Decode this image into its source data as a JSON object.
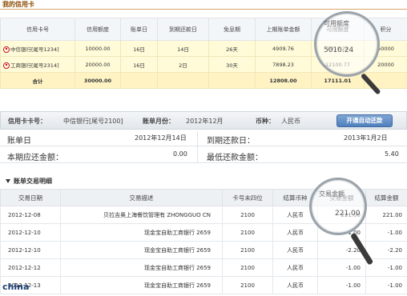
{
  "cards_panel": {
    "title": "我的信用卡",
    "headers": [
      "信用卡号",
      "信用额度",
      "账单日",
      "到期还款日",
      "免息期",
      "上期账单金额",
      "可用额度",
      "积分"
    ],
    "rows": [
      {
        "bank": "中信银行[尾号1234]",
        "limit": "10000.00",
        "bill_day": "16日",
        "due_day": "14日",
        "interest_free": "26天",
        "last_bill": "4909.76",
        "available": "5010.24",
        "points": "50000"
      },
      {
        "bank": "工商银行[尾号2314]",
        "limit": "20000.00",
        "bill_day": "16日",
        "due_day": "2日",
        "interest_free": "30天",
        "last_bill": "7898.23",
        "available": "12100.77",
        "points": "20000"
      }
    ],
    "total": {
      "label": "合计",
      "limit": "30000.00",
      "last_bill": "12808.00",
      "available": "17111.01"
    }
  },
  "bill_header": {
    "card_label": "信用卡卡号：",
    "card_value": "中信银行[尾号2100]",
    "month_label": "账单月份：",
    "month_value": "2012年12月",
    "currency_label": "币种：",
    "currency_value": "人民币",
    "auto_repay_button": "开通自动还款"
  },
  "bill_summary": {
    "bill_date_label": "账单日",
    "bill_date_value": "2012年12月14日",
    "due_date_label": "到期还款日：",
    "due_date_value": "2013年1月2日",
    "current_due_label": "本期应还金额：",
    "current_due_value": "0.00",
    "min_due_label": "最低还款金额：",
    "min_due_value": "5.40"
  },
  "transactions": {
    "section_title": "账单交易明细",
    "headers": [
      "交易日期",
      "交易描述",
      "卡号末四位",
      "结算币种",
      "交易金额",
      "结算金额"
    ],
    "rows": [
      {
        "date": "2012-12-08",
        "desc": "贝拉吉奥上海餐饮管理有 ZHONGGUO CN",
        "card": "2100",
        "currency": "人民币",
        "amount": "221.00",
        "settle": "221.00"
      },
      {
        "date": "2012-12-10",
        "desc": "现金宝自助工商银行 2659",
        "card": "2100",
        "currency": "人民币",
        "amount": "-1.00",
        "settle": "-1.00"
      },
      {
        "date": "2012-12-10",
        "desc": "现金宝自助工商银行 2659",
        "card": "2100",
        "currency": "人民币",
        "amount": "-2.20",
        "settle": "-2.20"
      },
      {
        "date": "2012-12-12",
        "desc": "现金宝自助工商银行 2659",
        "card": "2100",
        "currency": "人民币",
        "amount": "-1.00",
        "settle": "-1.00"
      },
      {
        "date": "2012-12-13",
        "desc": "现金宝自助工商银行 2659",
        "card": "2100",
        "currency": "人民币",
        "amount": "-1.00",
        "settle": "-1.00"
      }
    ]
  },
  "magnifier_top": {
    "label": "可用额度",
    "value": "5010.24"
  },
  "magnifier_bottom": {
    "label": "交易金额",
    "value": "221.00"
  },
  "watermark": "china"
}
